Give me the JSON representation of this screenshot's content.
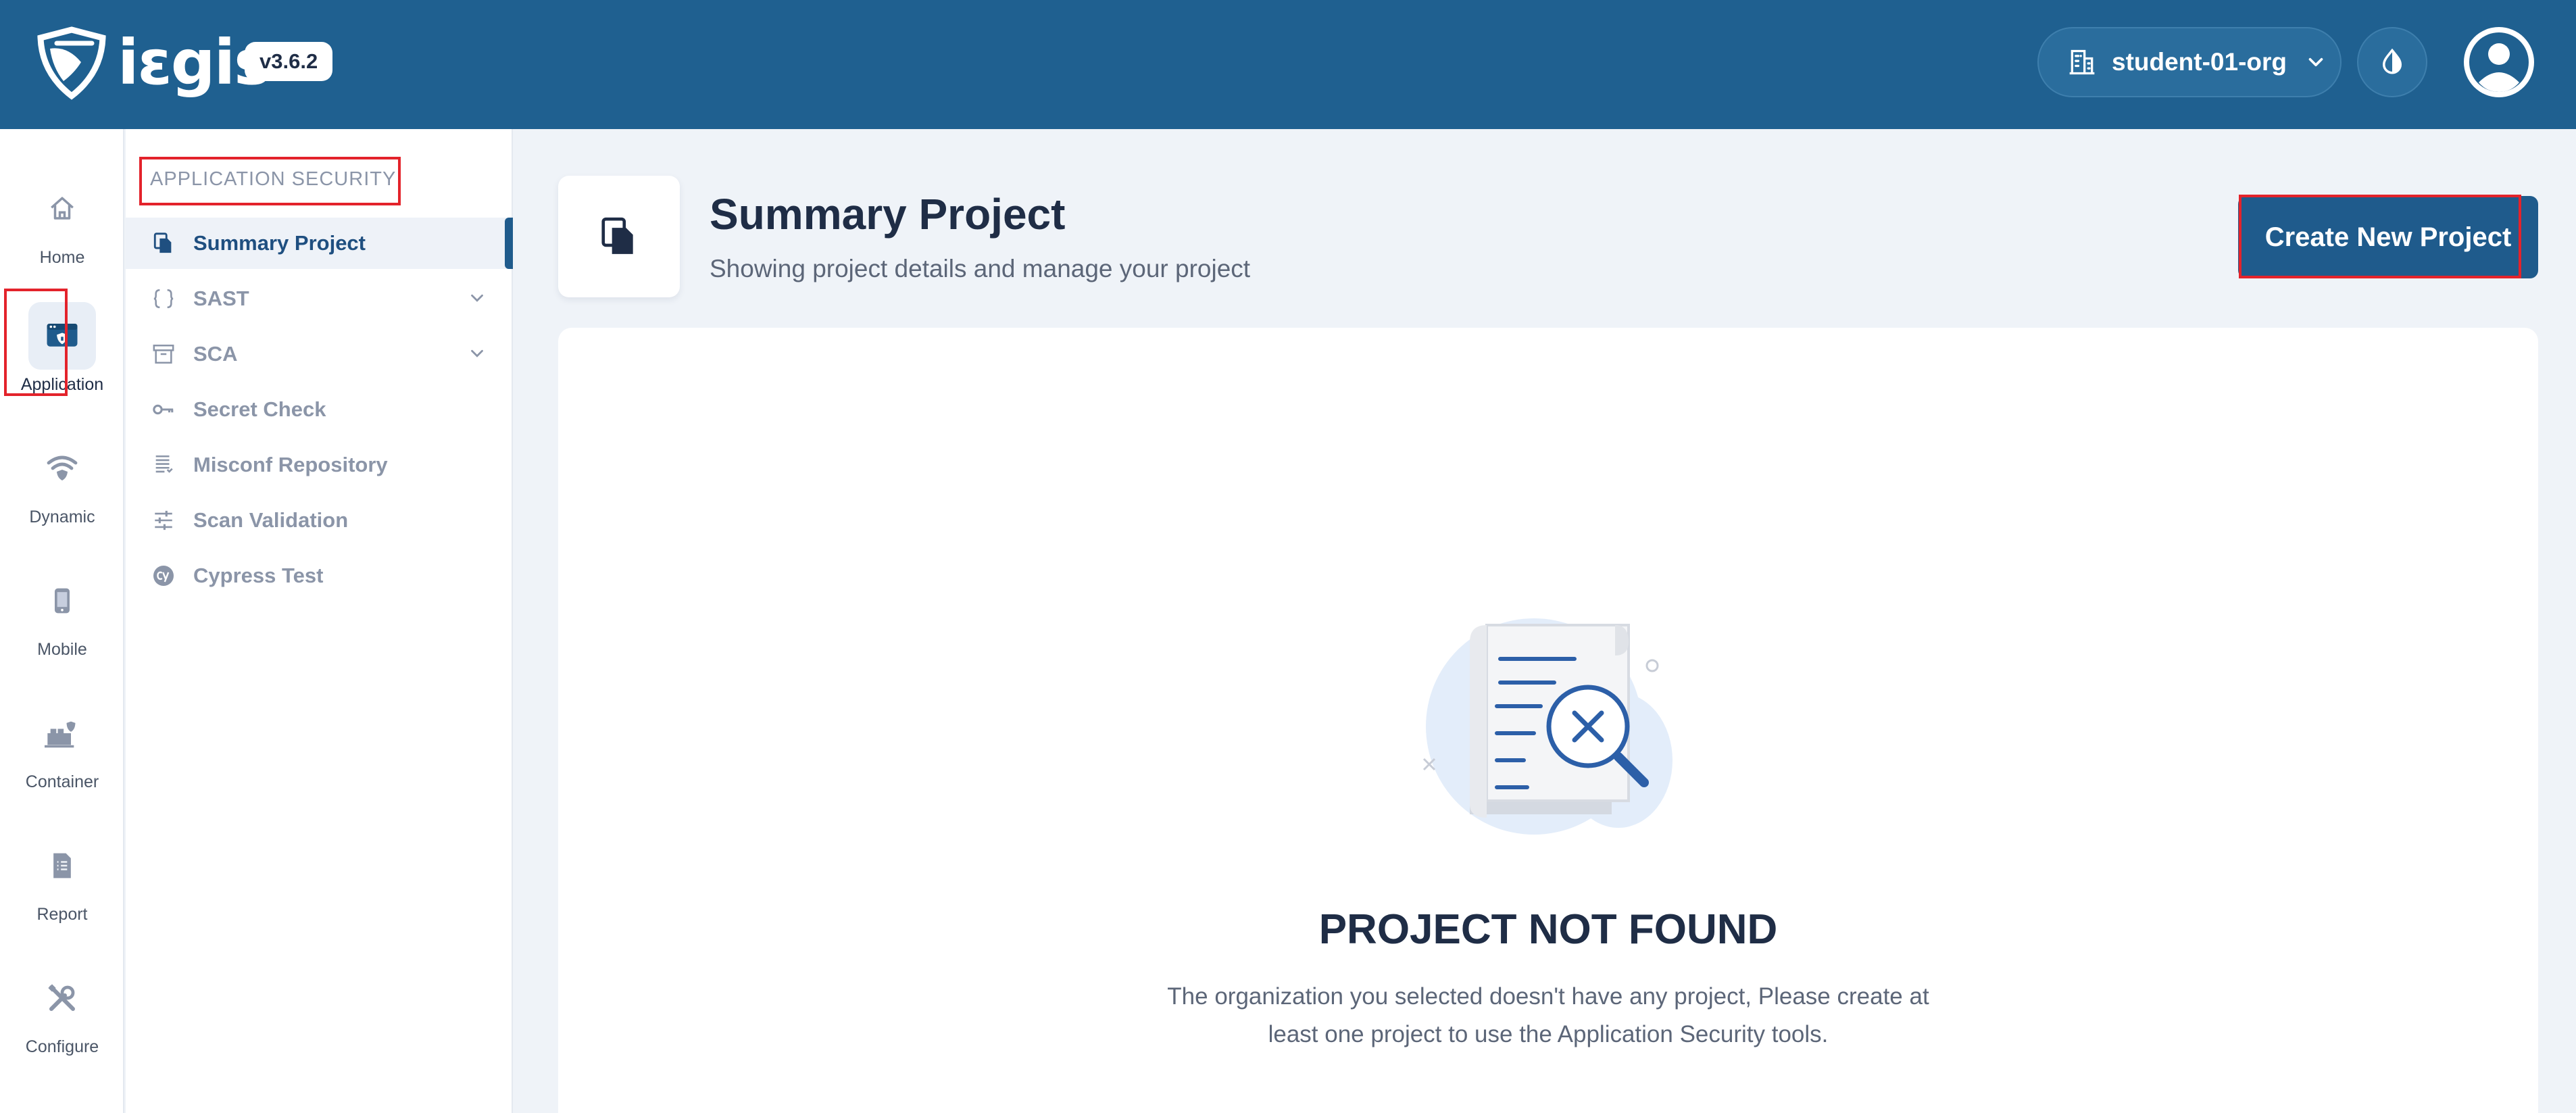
{
  "header": {
    "brand": "iεgis",
    "version": "v3.6.2",
    "org": "student-01-org",
    "icons": {
      "org": "building-icon",
      "chevron": "chevron-down-icon",
      "theme": "contrast-icon",
      "avatar": "user-avatar-icon"
    }
  },
  "rail": {
    "items": [
      {
        "label": "Home",
        "icon": "home-icon"
      },
      {
        "label": "Application",
        "icon": "application-icon",
        "active": true
      },
      {
        "label": "Dynamic",
        "icon": "wifi-shield-icon"
      },
      {
        "label": "Mobile",
        "icon": "mobile-icon"
      },
      {
        "label": "Container",
        "icon": "container-icon"
      },
      {
        "label": "Report",
        "icon": "report-icon"
      },
      {
        "label": "Configure",
        "icon": "tools-icon"
      }
    ]
  },
  "subnav": {
    "title": "APPLICATION SECURITY",
    "items": [
      {
        "label": "Summary Project",
        "icon": "copy-icon",
        "active": true
      },
      {
        "label": "SAST",
        "icon": "braces-icon",
        "expandable": true
      },
      {
        "label": "SCA",
        "icon": "archive-icon",
        "expandable": true
      },
      {
        "label": "Secret Check",
        "icon": "key-icon"
      },
      {
        "label": "Misconf Repository",
        "icon": "document-list-icon"
      },
      {
        "label": "Scan Validation",
        "icon": "sliders-icon"
      },
      {
        "label": "Cypress Test",
        "icon": "cypress-icon"
      }
    ]
  },
  "main": {
    "title": "Summary Project",
    "subtitle": "Showing project details and manage your project",
    "create_button": "Create New Project",
    "empty": {
      "title": "PROJECT NOT FOUND",
      "line1": "The organization you selected doesn't have any project, Please create at",
      "line2": "least one project to use the Application Security tools."
    }
  },
  "colors": {
    "header": "#1f6090",
    "primary": "#1f5b8c",
    "highlight": "#e3232b",
    "background": "#eff3f8"
  }
}
